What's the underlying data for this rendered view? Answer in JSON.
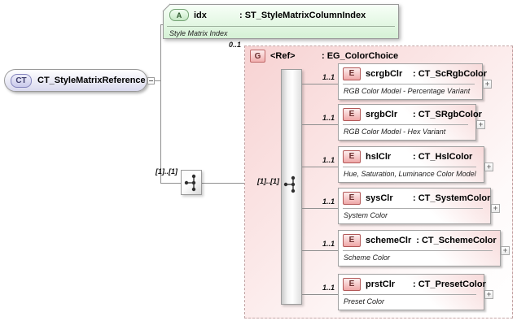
{
  "root": {
    "badge": "CT",
    "label": "CT_StyleMatrixReference"
  },
  "attribute": {
    "badge": "A",
    "name": "idx",
    "type": ": ST_StyleMatrixColumnIndex",
    "annotation": "Style Matrix Index"
  },
  "root_choice": {
    "cardinality": "[1]..[1]",
    "icon": "choice-icon"
  },
  "group": {
    "cardinality": "0..1",
    "badge": "G",
    "name": "<Ref>",
    "type": ": EG_ColorChoice",
    "choice_cardinality": "[1]..[1]",
    "icon": "choice-icon"
  },
  "expand_glyph": "+",
  "elements": [
    {
      "cardinality": "1..1",
      "badge": "E",
      "name": "scrgbClr",
      "type": ": CT_ScRgbColor",
      "annotation": "RGB Color Model - Percentage Variant"
    },
    {
      "cardinality": "1..1",
      "badge": "E",
      "name": "srgbClr",
      "type": ": CT_SRgbColor",
      "annotation": "RGB Color Model - Hex Variant"
    },
    {
      "cardinality": "1..1",
      "badge": "E",
      "name": "hslClr",
      "type": ": CT_HslColor",
      "annotation": "Hue, Saturation, Luminance Color Model"
    },
    {
      "cardinality": "1..1",
      "badge": "E",
      "name": "sysClr",
      "type": ": CT_SystemColor",
      "annotation": "System Color"
    },
    {
      "cardinality": "1..1",
      "badge": "E",
      "name": "schemeClr",
      "type": ": CT_SchemeColor",
      "annotation": "Scheme Color"
    },
    {
      "cardinality": "1..1",
      "badge": "E",
      "name": "prstClr",
      "type": ": CT_PresetColor",
      "annotation": "Preset Color"
    }
  ],
  "colors": {
    "group_fill": "#f7d2d2",
    "element_badge": "#efa7a7",
    "attribute_fill": "#d5f1d5",
    "root_fill": "#d9d9ee",
    "connector": "#8f8f8f"
  }
}
